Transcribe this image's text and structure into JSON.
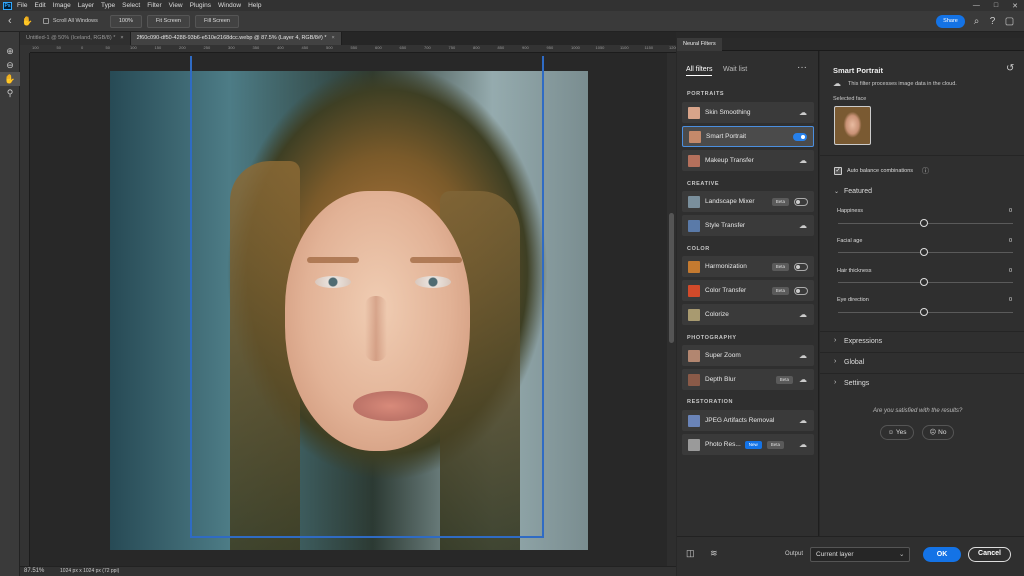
{
  "app": {
    "logo": "Ps",
    "menu": [
      "File",
      "Edit",
      "Image",
      "Layer",
      "Type",
      "Select",
      "Filter",
      "View",
      "Plugins",
      "Window",
      "Help"
    ],
    "window_controls": [
      "—",
      "□",
      "✕"
    ]
  },
  "options_bar": {
    "back_icon": "chevron-left-icon",
    "hand_icon": "hand-icon",
    "scroll_all_windows": "Scroll All Windows",
    "zoom_100": "100%",
    "fit_screen": "Fit Screen",
    "fill_screen": "Fill Screen",
    "share": "Share",
    "share_color": "#1473e6"
  },
  "toolbar": {
    "tools": [
      {
        "icon": "zoom-in-icon",
        "glyph": "⊕"
      },
      {
        "icon": "zoom-out-icon",
        "glyph": "⊖"
      },
      {
        "icon": "hand-icon",
        "glyph": "✋"
      },
      {
        "icon": "magnifier-icon",
        "glyph": "⚲"
      }
    ]
  },
  "tabs": [
    {
      "label": "Untitled-1 @ 50% (Iceland, RGB/8) *",
      "close": "×",
      "active": false
    },
    {
      "label": "2f60c090-df50-4288-93b6-e510e2168dcc.webp @ 87.5% (Layer 4, RGB/8#) *",
      "close": "×",
      "active": true
    }
  ],
  "ruler": {
    "labels": [
      "100",
      "50",
      "0",
      "50",
      "100",
      "150",
      "200",
      "250",
      "300",
      "350",
      "400",
      "450",
      "500",
      "550",
      "600",
      "650",
      "700",
      "750",
      "800",
      "850",
      "900",
      "950",
      "1000",
      "1050",
      "1100",
      "1150",
      "1200"
    ]
  },
  "status": {
    "zoom": "87.51%",
    "doc_info": "1024 px x 1024 px (72 ppi)"
  },
  "neural_filters": {
    "panel_title": "Neural Filters",
    "tabs": {
      "all": "All filters",
      "wait": "Wait list"
    },
    "more": "···",
    "categories": [
      {
        "name": "PORTRAITS",
        "filters": [
          {
            "name": "Skin Smoothing",
            "control": "cloud",
            "thumb": "#d8a48a"
          },
          {
            "name": "Smart Portrait",
            "control": "toggle-on",
            "thumb": "#c4896a"
          },
          {
            "name": "Makeup Transfer",
            "control": "cloud",
            "thumb": "#b4705c"
          }
        ]
      },
      {
        "name": "CREATIVE",
        "filters": [
          {
            "name": "Landscape Mixer",
            "badge": "Beta",
            "control": "toggle-off",
            "thumb": "#7a8f9c"
          },
          {
            "name": "Style Transfer",
            "control": "cloud",
            "thumb": "#5a7aa8"
          }
        ]
      },
      {
        "name": "COLOR",
        "filters": [
          {
            "name": "Harmonization",
            "badge": "Beta",
            "control": "toggle-off",
            "thumb": "#c47a30"
          },
          {
            "name": "Color Transfer",
            "badge": "Beta",
            "control": "toggle-off",
            "thumb": "#d24a2a"
          },
          {
            "name": "Colorize",
            "control": "cloud",
            "thumb": "#a89a70"
          }
        ]
      },
      {
        "name": "PHOTOGRAPHY",
        "filters": [
          {
            "name": "Super Zoom",
            "control": "cloud",
            "thumb": "#b28670"
          },
          {
            "name": "Depth Blur",
            "badge": "Beta",
            "control": "cloud",
            "thumb": "#8a5a48"
          }
        ]
      },
      {
        "name": "RESTORATION",
        "filters": [
          {
            "name": "JPEG Artifacts Removal",
            "control": "cloud",
            "thumb": "#6a84b8"
          },
          {
            "name": "Photo Res...",
            "badge_new": "New",
            "badge": "Beta",
            "control": "cloud",
            "thumb": "#9a9a9a"
          }
        ]
      }
    ]
  },
  "smart_portrait": {
    "title": "Smart Portrait",
    "cloud_note": "This filter processes image data in the cloud.",
    "selected_face": "Selected face",
    "auto_balance": "Auto balance combinations",
    "featured": "Featured",
    "sliders": [
      {
        "label": "Happiness",
        "value": "0",
        "level": 0
      },
      {
        "label": "Facial age",
        "value": "0",
        "level": 0
      },
      {
        "label": "Hair thickness",
        "value": "0",
        "level": 0
      },
      {
        "label": "Eye direction",
        "value": "0",
        "level": 0
      }
    ],
    "sections": [
      "Expressions",
      "Global",
      "Settings"
    ],
    "feedback_q": "Are you satisfied with the results?",
    "yes": "Yes",
    "no": "No"
  },
  "bottom": {
    "output_label": "Output",
    "output_value": "Current layer",
    "ok": "OK",
    "cancel": "Cancel",
    "ok_color": "#1473e6"
  }
}
